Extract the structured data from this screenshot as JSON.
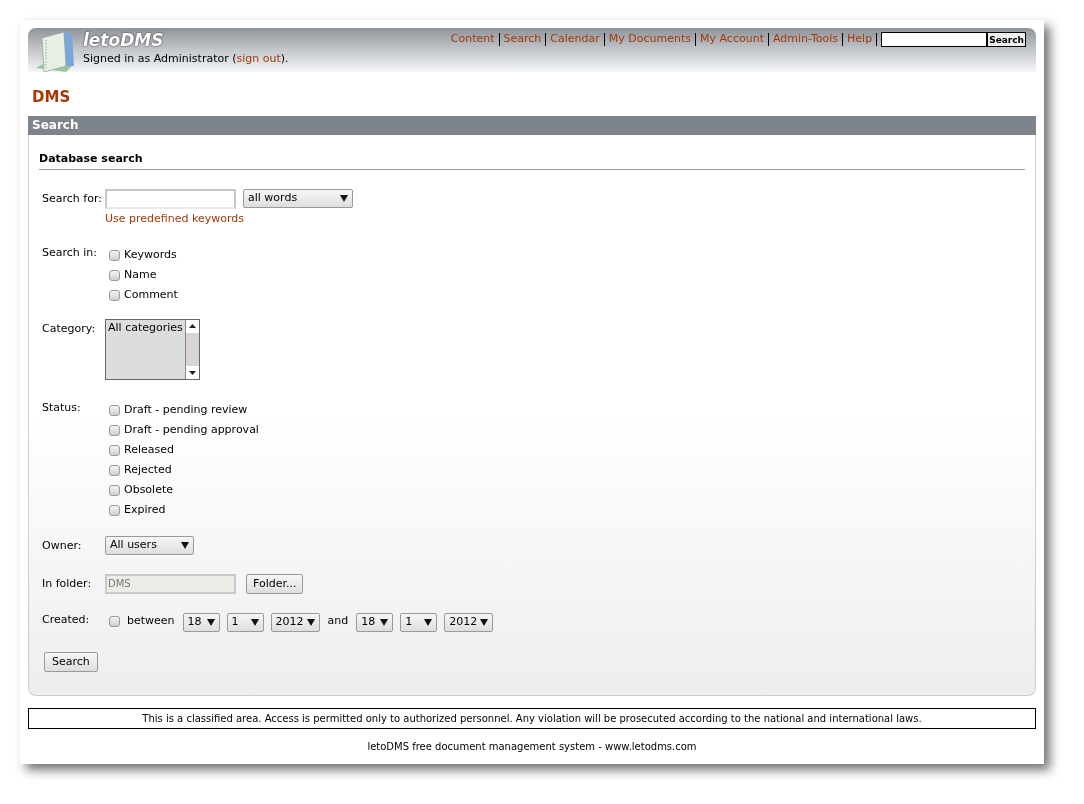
{
  "header": {
    "app_name": "letoDMS",
    "signed_in_prefix": "Signed in as Administrator (",
    "sign_out": "sign out",
    "signed_in_suffix": ").",
    "nav": [
      {
        "label": "Content"
      },
      {
        "label": "Search"
      },
      {
        "label": "Calendar"
      },
      {
        "label": "My Documents"
      },
      {
        "label": "My Account"
      },
      {
        "label": "Admin-Tools"
      },
      {
        "label": "Help"
      }
    ],
    "quick_search": {
      "button": "Search"
    }
  },
  "folder_title": "DMS",
  "section_title": "Search",
  "form": {
    "heading": "Database search",
    "search_for": {
      "label": "Search for:",
      "mode": "all words",
      "link": "Use predefined keywords"
    },
    "search_in": {
      "label": "Search in:",
      "options": [
        {
          "label": "Keywords",
          "checked": false
        },
        {
          "label": "Name",
          "checked": false
        },
        {
          "label": "Comment",
          "checked": false
        }
      ]
    },
    "category": {
      "label": "Category:",
      "options": [
        {
          "label": "All categories"
        }
      ]
    },
    "status": {
      "label": "Status:",
      "options": [
        {
          "label": "Draft - pending review",
          "checked": false
        },
        {
          "label": "Draft - pending approval",
          "checked": false
        },
        {
          "label": "Released",
          "checked": false
        },
        {
          "label": "Rejected",
          "checked": false
        },
        {
          "label": "Obsolete",
          "checked": false
        },
        {
          "label": "Expired",
          "checked": false
        }
      ]
    },
    "owner": {
      "label": "Owner:",
      "value": "All users"
    },
    "in_folder": {
      "label": "In folder:",
      "value": "DMS",
      "button": "Folder..."
    },
    "created": {
      "label": "Created:",
      "checked": false,
      "between": "between",
      "from": [
        "18",
        "1",
        "2012"
      ],
      "and": "and",
      "to": [
        "18",
        "1",
        "2012"
      ]
    },
    "submit": "Search"
  },
  "notice": "This is a classified area. Access is permitted only to authorized personnel. Any violation will be prosecuted according to the national and international laws.",
  "footer": "letoDMS free document management system - www.letodms.com"
}
